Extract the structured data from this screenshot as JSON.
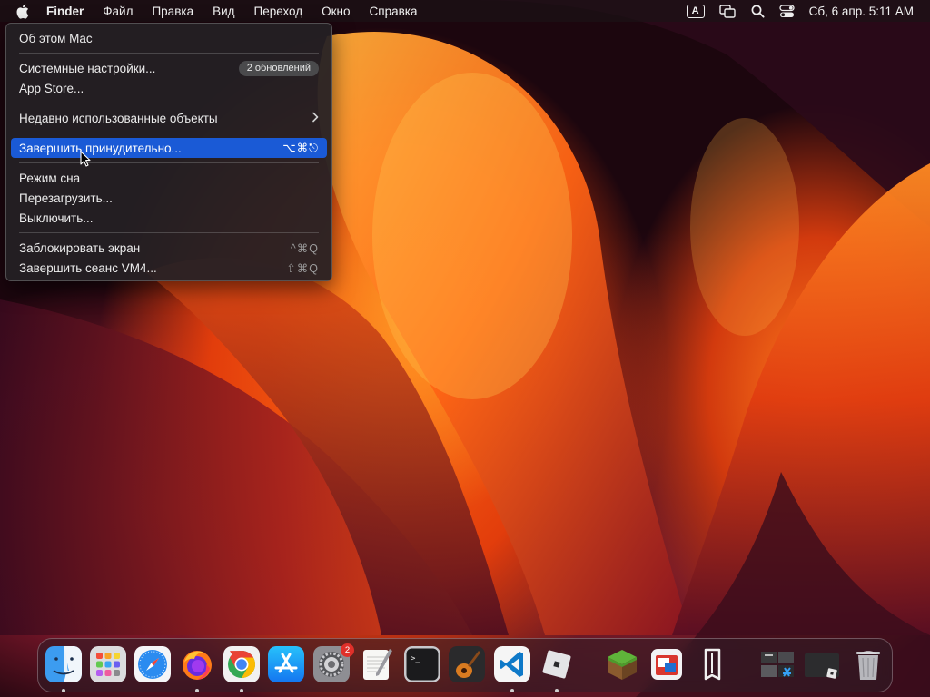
{
  "menubar": {
    "app_name": "Finder",
    "items": [
      "Файл",
      "Правка",
      "Вид",
      "Переход",
      "Окно",
      "Справка"
    ],
    "input_source": "A",
    "clock": "Сб, 6 апр.  5:11 AM"
  },
  "apple_menu": {
    "about": "Об этом Mac",
    "system_settings": "Системные настройки...",
    "updates_badge": "2 обновлений",
    "app_store": "App Store...",
    "recent_items": "Недавно использованные объекты",
    "force_quit": "Завершить принудительно...",
    "force_quit_shortcut": "⌥⌘⎋",
    "sleep": "Режим сна",
    "restart": "Перезагрузить...",
    "shutdown": "Выключить...",
    "lock_screen": "Заблокировать экран",
    "lock_shortcut": "^⌘Q",
    "logout": "Завершить сеанс VM4...",
    "logout_shortcut": "⇧⌘Q"
  },
  "dock": {
    "apps": [
      "finder",
      "launchpad",
      "safari",
      "firefox",
      "chrome",
      "app-store",
      "system-settings",
      "textedit",
      "terminal",
      "garageband",
      "vscode",
      "roblox",
      "minecraft",
      "sql-app",
      "bitwarden-like",
      "downloads-stack",
      "desktop-stack",
      "trash"
    ],
    "system_settings_badge": "2"
  },
  "colors": {
    "highlight": "#1a5ad6",
    "badge_red": "#e0302a"
  }
}
